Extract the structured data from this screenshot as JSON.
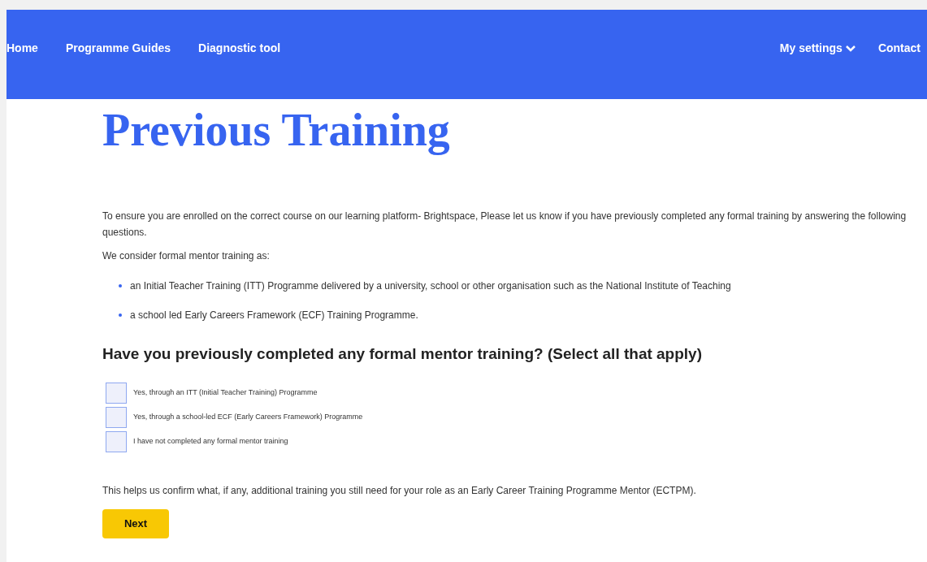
{
  "nav": {
    "left": [
      "Home",
      "Programme Guides",
      "Diagnostic tool"
    ],
    "settings": "My settings",
    "contact": "Contact"
  },
  "title": "Previous Training",
  "intro": "To ensure you are enrolled on the correct course on our learning platform- Brightspace, Please let us know if you have previously completed any formal training by answering the following questions.",
  "consider": "We consider formal mentor training as:",
  "bullets": [
    "an Initial Teacher Training (ITT) Programme delivered by a university, school or other organisation such as the National Institute of Teaching",
    "a school led Early Careers Framework (ECF) Training Programme."
  ],
  "question": "Have you previously completed any formal mentor training? (Select all that apply)",
  "options": [
    {
      "label": "Yes, through an ITT (Initial Teacher Training) Programme",
      "checked": false
    },
    {
      "label": "Yes, through a school-led ECF (Early Careers Framework) Programme",
      "checked": false
    },
    {
      "label": "I have not completed any formal mentor training",
      "checked": false
    }
  ],
  "note": "This helps us confirm what, if any, additional training you still need for your role as an Early Career Training Programme Mentor (ECTPM).",
  "next_button": "Next"
}
